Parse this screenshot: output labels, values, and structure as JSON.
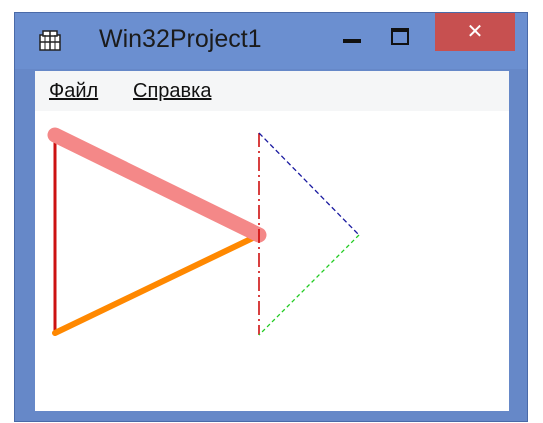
{
  "window": {
    "title": "Win32Project1",
    "app_icon": "application-icon",
    "controls": {
      "minimize_icon": "minimize-icon",
      "maximize_icon": "maximize-icon",
      "close_label": "✕"
    },
    "frame_color": "#6b8fd0",
    "close_color": "#c75050"
  },
  "menubar": {
    "items": [
      {
        "label": "Файл"
      },
      {
        "label": "Справка"
      }
    ]
  },
  "canvas": {
    "colors": {
      "thick_top": "#f48888",
      "left_vertical": "#cc1111",
      "bottom_orange": "#ff8800",
      "red_dashed": "#cc0000",
      "blue_dashed": "#1a1aa0",
      "green_dashed": "#22cc22"
    }
  }
}
